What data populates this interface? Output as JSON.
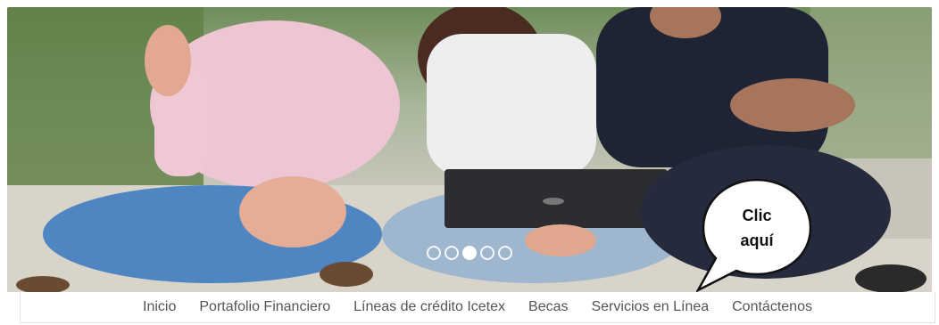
{
  "hero": {
    "carousel_dots": [
      {
        "active": false
      },
      {
        "active": false
      },
      {
        "active": true
      },
      {
        "active": false
      },
      {
        "active": false
      }
    ],
    "callout": {
      "line1": "Clic",
      "line2": "aquí"
    }
  },
  "nav": {
    "items": [
      {
        "label": "Inicio"
      },
      {
        "label": "Portafolio Financiero"
      },
      {
        "label": "Líneas de crédito Icetex"
      },
      {
        "label": "Becas"
      },
      {
        "label": "Servicios en Línea"
      },
      {
        "label": "Contáctenos"
      }
    ]
  },
  "colors": {
    "nav_text": "#555555",
    "callout_text": "#111111"
  }
}
